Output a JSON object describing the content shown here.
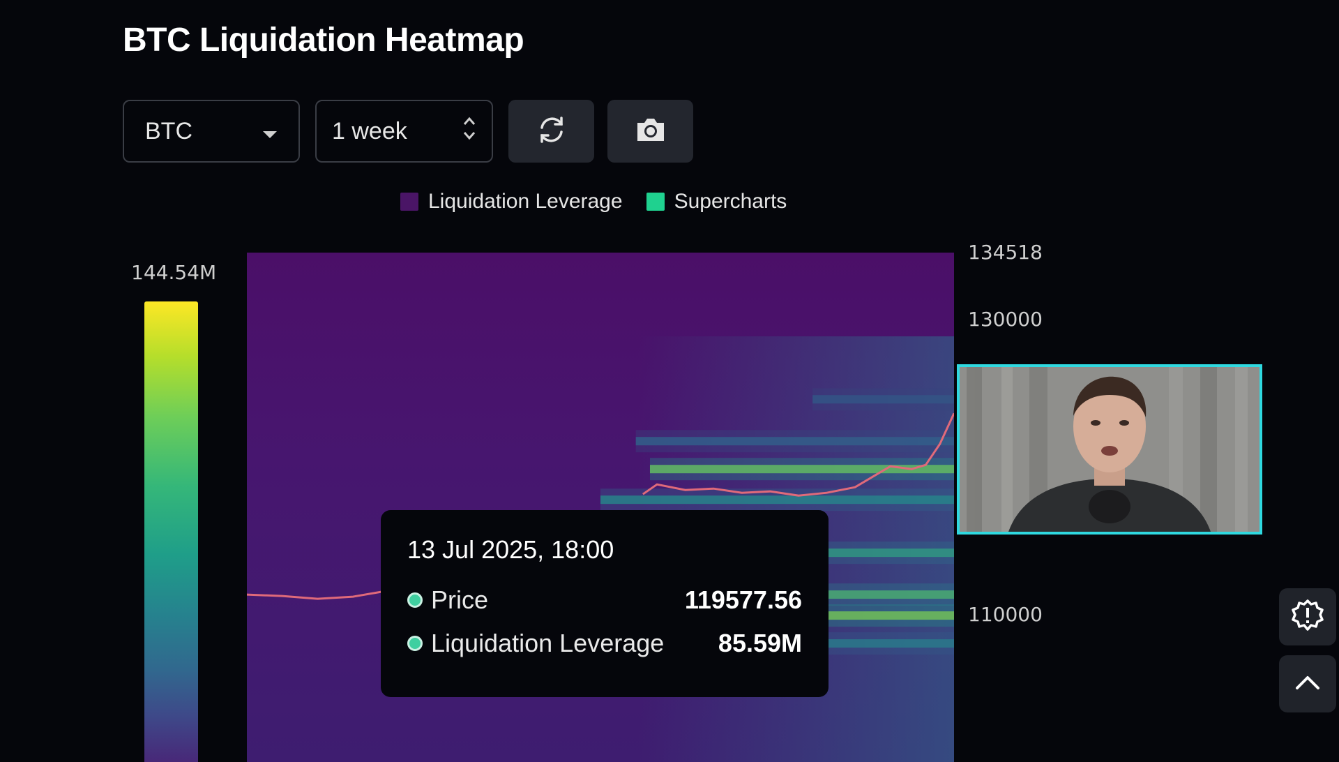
{
  "title": "BTC Liquidation Heatmap",
  "controls": {
    "symbol": "BTC",
    "range": "1 week"
  },
  "legend": [
    {
      "label": "Liquidation Leverage",
      "color": "#4a1566"
    },
    {
      "label": "Supercharts",
      "color": "#1fd18f"
    }
  ],
  "colorbar": {
    "max_label": "144.54M"
  },
  "chart_data": {
    "type": "heatmap",
    "y_ticks": [
      "134518",
      "130000",
      "110000"
    ],
    "ylim": [
      98000,
      134518
    ],
    "price_series": [
      {
        "t": 0.0,
        "p": 110000
      },
      {
        "t": 0.05,
        "p": 109900
      },
      {
        "t": 0.1,
        "p": 109700
      },
      {
        "t": 0.15,
        "p": 109850
      },
      {
        "t": 0.19,
        "p": 110200
      },
      {
        "t": 0.56,
        "p": 117200
      },
      {
        "t": 0.58,
        "p": 117900
      },
      {
        "t": 0.62,
        "p": 117500
      },
      {
        "t": 0.66,
        "p": 117600
      },
      {
        "t": 0.7,
        "p": 117300
      },
      {
        "t": 0.74,
        "p": 117400
      },
      {
        "t": 0.78,
        "p": 117100
      },
      {
        "t": 0.82,
        "p": 117300
      },
      {
        "t": 0.86,
        "p": 117700
      },
      {
        "t": 0.89,
        "p": 118600
      },
      {
        "t": 0.91,
        "p": 119200
      },
      {
        "t": 0.94,
        "p": 119000
      },
      {
        "t": 0.96,
        "p": 119300
      },
      {
        "t": 0.98,
        "p": 120800
      },
      {
        "t": 1.0,
        "p": 123000
      }
    ],
    "hot_bands": [
      {
        "price": 119000,
        "t_start": 0.57,
        "intensity": 0.85
      },
      {
        "price": 116800,
        "t_start": 0.5,
        "intensity": 0.55
      },
      {
        "price": 113000,
        "t_start": 0.72,
        "intensity": 0.65
      },
      {
        "price": 110000,
        "t_start": 0.7,
        "intensity": 0.75
      },
      {
        "price": 108500,
        "t_start": 0.7,
        "intensity": 0.9
      },
      {
        "price": 106500,
        "t_start": 0.7,
        "intensity": 0.5
      },
      {
        "price": 121000,
        "t_start": 0.55,
        "intensity": 0.35
      },
      {
        "price": 124000,
        "t_start": 0.8,
        "intensity": 0.3
      }
    ]
  },
  "tooltip": {
    "time": "13 Jul 2025, 18:00",
    "rows": [
      {
        "label": "Price",
        "value": "119577.56"
      },
      {
        "label": "Liquidation Leverage",
        "value": "85.59M"
      }
    ]
  },
  "icons": {
    "refresh": "refresh-icon",
    "camera": "camera-icon",
    "alert": "alert-badge-icon",
    "up": "chevron-up-icon"
  }
}
